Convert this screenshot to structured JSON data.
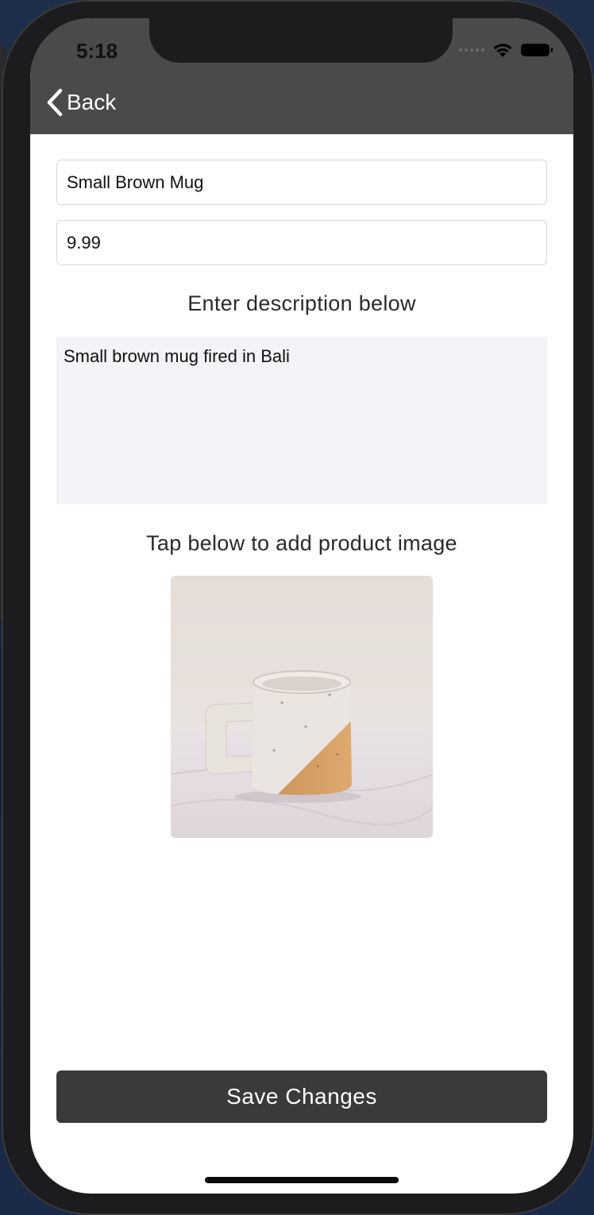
{
  "status_bar": {
    "time": "5:18",
    "icons": [
      "cellular-dots-icon",
      "wifi-icon",
      "battery-icon"
    ]
  },
  "nav": {
    "back_label": "Back",
    "background": "#4a4a4a"
  },
  "form": {
    "name_value": "Small Brown Mug",
    "price_value": "9.99",
    "description_label": "Enter description below",
    "description_value": "Small brown mug fired in Bali",
    "image_label": "Tap below to add product image",
    "image_subject": "ceramic mug"
  },
  "actions": {
    "save_label": "Save Changes",
    "save_color": "#3a3a3a"
  }
}
